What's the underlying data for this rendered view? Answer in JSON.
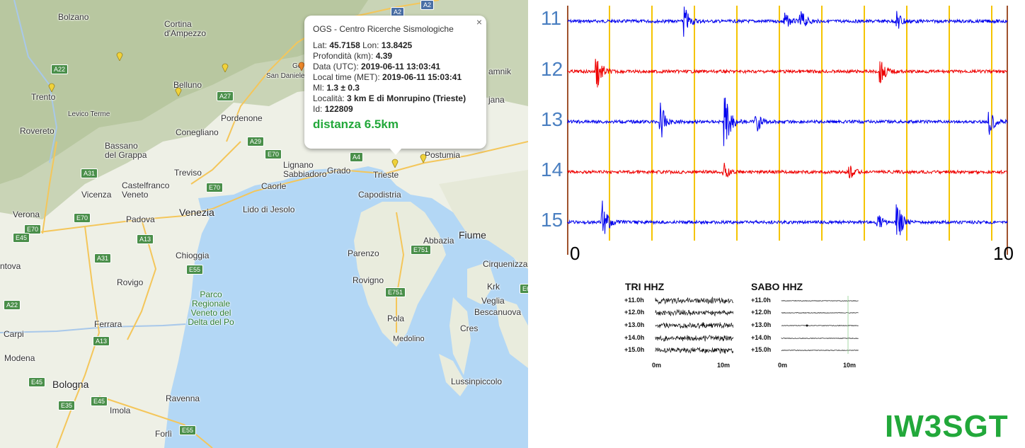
{
  "map": {
    "cities": [
      {
        "name": "Bolzano",
        "cls": "city"
      },
      {
        "name": "Cortina d'Ampezzo",
        "cls": "city"
      },
      {
        "name": "Trento",
        "cls": "city"
      },
      {
        "name": "Belluno",
        "cls": "city"
      },
      {
        "name": "Pordenone",
        "cls": "city"
      },
      {
        "name": "Rovereto",
        "cls": "city"
      },
      {
        "name": "Bassano del Grappa",
        "cls": "city"
      },
      {
        "name": "Conegliano",
        "cls": "city"
      },
      {
        "name": "Treviso",
        "cls": "city"
      },
      {
        "name": "Vicenza",
        "cls": "city"
      },
      {
        "name": "Castelfranco Veneto",
        "cls": "city"
      },
      {
        "name": "Verona",
        "cls": "city"
      },
      {
        "name": "Padova",
        "cls": "city"
      },
      {
        "name": "Venezia",
        "cls": "big"
      },
      {
        "name": "Lido di Jesolo",
        "cls": "city"
      },
      {
        "name": "Caorle",
        "cls": "city"
      },
      {
        "name": "Lignano Sabbiadoro",
        "cls": "city"
      },
      {
        "name": "Grado",
        "cls": "city"
      },
      {
        "name": "Trieste",
        "cls": "city"
      },
      {
        "name": "Capodistria",
        "cls": "city"
      },
      {
        "name": "Postumia",
        "cls": "city"
      },
      {
        "name": "Chioggia",
        "cls": "city"
      },
      {
        "name": "Rovigo",
        "cls": "city"
      },
      {
        "name": "Parenzo",
        "cls": "city"
      },
      {
        "name": "Rovigno",
        "cls": "city"
      },
      {
        "name": "Fiume",
        "cls": "big"
      },
      {
        "name": "Abbazia",
        "cls": "city"
      },
      {
        "name": "Cirquenizza",
        "cls": "city"
      },
      {
        "name": "Krk",
        "cls": "city"
      },
      {
        "name": "Veglia",
        "cls": "city"
      },
      {
        "name": "Bescanuova",
        "cls": "city"
      },
      {
        "name": "Cres",
        "cls": "city"
      },
      {
        "name": "Pola",
        "cls": "city"
      },
      {
        "name": "Medolino",
        "cls": "city"
      },
      {
        "name": "Lussinpiccolo",
        "cls": "city"
      },
      {
        "name": "Ferrara",
        "cls": "city"
      },
      {
        "name": "Modena",
        "cls": "city"
      },
      {
        "name": "Bologna",
        "cls": "big"
      },
      {
        "name": "Imola",
        "cls": "city"
      },
      {
        "name": "Ravenna",
        "cls": "city"
      },
      {
        "name": "Forlì",
        "cls": "city"
      },
      {
        "name": "Carpi",
        "cls": "city"
      },
      {
        "name": "ntova",
        "cls": "city"
      },
      {
        "name": "San Daniele del Friuli",
        "cls": "city"
      },
      {
        "name": "Gem",
        "cls": "city"
      },
      {
        "name": "Levico Terme",
        "cls": "city"
      },
      {
        "name": "amnik",
        "cls": "city"
      },
      {
        "name": "jana",
        "cls": "city"
      }
    ],
    "park": "Parco Regionale Veneto del Delta del Po",
    "shields": [
      "A2",
      "A2",
      "A22",
      "A27",
      "A29",
      "E70",
      "A31",
      "E70",
      "A4",
      "E70",
      "E70",
      "E45",
      "A13",
      "A31",
      "E55",
      "A22",
      "A13",
      "E45",
      "E35",
      "E45",
      "E55",
      "E751",
      "E751",
      "E6"
    ]
  },
  "popup": {
    "title": "OGS - Centro Ricerche Sismologiche",
    "close": "×",
    "lat_label": "Lat:",
    "lat": "45.7158",
    "lon_label": "Lon:",
    "lon": "13.8425",
    "depth_label": "Profondità (km):",
    "depth": "4.39",
    "utc_label": "Data (UTC):",
    "utc": "2019-06-11 13:03:41",
    "met_label": "Local time (MET):",
    "met": "2019-06-11 15:03:41",
    "ml_label": "Ml:",
    "ml": "1.3 ± 0.3",
    "loc_label": "Località:",
    "loc": "3 km E di Monrupino (Trieste)",
    "id_label": "Id:",
    "id": "122809",
    "distance": "distanza 6.5km"
  },
  "seismo": {
    "rows": [
      "11",
      "12",
      "13",
      "14",
      "15"
    ],
    "row_colors": [
      "#0000ee",
      "#ee0000",
      "#0000ee",
      "#ee0000",
      "#0000ee"
    ],
    "x_start": "0",
    "x_end": "10",
    "grid_color": "#f5c400",
    "border_color": "#a0522d"
  },
  "mini": [
    {
      "title": "TRI HHZ",
      "rows": [
        "+11.0h",
        "+12.0h",
        "+13.0h",
        "+14.0h",
        "+15.0h"
      ],
      "x0": "0m",
      "x1": "10m"
    },
    {
      "title": "SABO HHZ",
      "rows": [
        "+11.0h",
        "+12.0h",
        "+13.0h",
        "+14.0h",
        "+15.0h"
      ],
      "x0": "0m",
      "x1": "10m"
    }
  ],
  "brand": "IW3SGT"
}
